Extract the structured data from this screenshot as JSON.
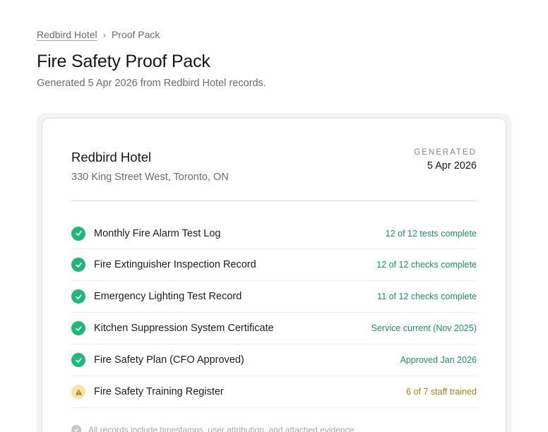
{
  "breadcrumb": {
    "parent": "Redbird Hotel",
    "separator": "›",
    "current": "Proof Pack"
  },
  "page": {
    "title": "Fire Safety Proof Pack",
    "subtitle": "Generated 5 Apr 2026 from Redbird Hotel records."
  },
  "card": {
    "hotel_name": "Redbird Hotel",
    "hotel_address": "330 King Street West, Toronto, ON",
    "generated_label": "GENERATED",
    "generated_date": "5 Apr 2026"
  },
  "records": [
    {
      "name": "Monthly Fire Alarm Test Log",
      "status": "12 of 12 tests complete",
      "state": "ok",
      "icon": "check-circle-icon"
    },
    {
      "name": "Fire Extinguisher Inspection Record",
      "status": "12 of 12 checks complete",
      "state": "ok",
      "icon": "check-circle-icon"
    },
    {
      "name": "Emergency Lighting Test Record",
      "status": "11 of 12 checks complete",
      "state": "ok",
      "icon": "check-circle-icon"
    },
    {
      "name": "Kitchen Suppression System Certificate",
      "status": "Service current (Nov 2025)",
      "state": "ok",
      "icon": "check-circle-icon"
    },
    {
      "name": "Fire Safety Plan (CFO Approved)",
      "status": "Approved Jan 2026",
      "state": "ok",
      "icon": "check-circle-icon"
    },
    {
      "name": "Fire Safety Training Register",
      "status": "6 of 7 staff trained",
      "state": "warn",
      "icon": "warning-icon"
    }
  ],
  "footnote": "All records include timestamps, user attribution, and attached evidence.",
  "colors": {
    "ok": "#1eb97a",
    "ok_text": "#179460",
    "warn": "#f8e4a8",
    "warn_text": "#a9800f"
  }
}
